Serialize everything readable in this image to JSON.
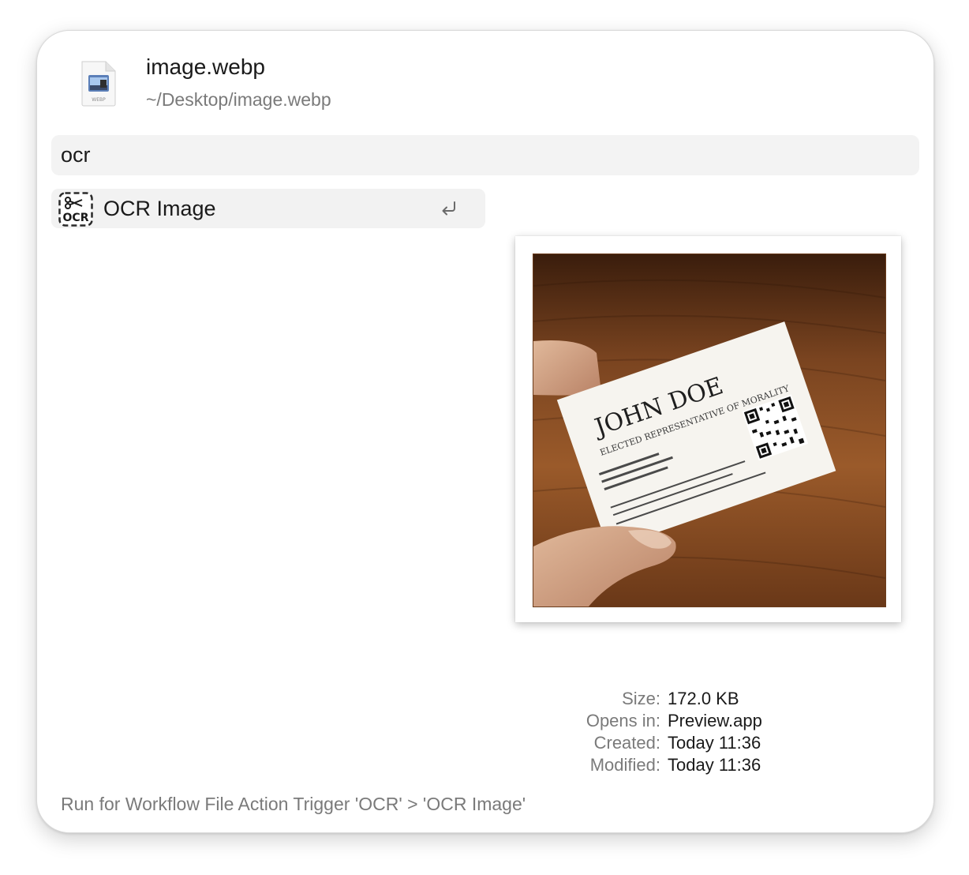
{
  "file": {
    "name": "image.webp",
    "path": "~/Desktop/image.webp",
    "icon": "webp-file-icon",
    "icon_label": "WEBP"
  },
  "search": {
    "value": "ocr",
    "placeholder": ""
  },
  "results": [
    {
      "icon": "ocr-scissors-icon",
      "icon_text": "OCR",
      "label": "OCR Image",
      "shortcut_icon": "return-key-icon"
    }
  ],
  "preview": {
    "card_name": "JOHN DOE",
    "card_title": "ELECTED REPRESENTATIVE OF MORALITY"
  },
  "metadata": {
    "size_label": "Size:",
    "size_value": "172.0 KB",
    "opens_label": "Opens in:",
    "opens_value": "Preview.app",
    "created_label": "Created:",
    "created_value": "Today 11:36",
    "modified_label": "Modified:",
    "modified_value": "Today 11:36"
  },
  "footer": {
    "text": "Run for Workflow File Action Trigger 'OCR' > 'OCR Image'"
  },
  "colors": {
    "window_bg": "#ffffff",
    "field_bg": "#f3f3f3",
    "selected_bg": "#f2f2f2",
    "secondary_text": "#7a7a7a",
    "primary_text": "#1a1a1a"
  }
}
